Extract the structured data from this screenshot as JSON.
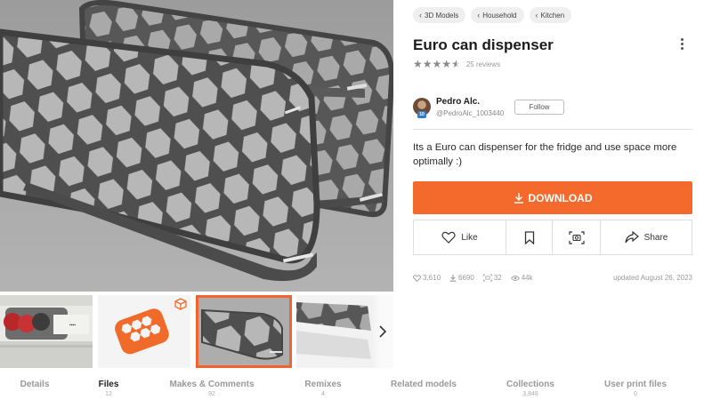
{
  "breadcrumbs": [
    "3D Models",
    "Household",
    "Kitchen"
  ],
  "model": {
    "title": "Euro can dispenser",
    "rating": 4.5,
    "reviews": "25 reviews",
    "description": "Its a Euro can dispenser for the fridge and use space more optimally :)"
  },
  "author": {
    "name": "Pedro Alc.",
    "handle": "@PedroAlc_1003440",
    "badge": "10",
    "follow_label": "Follow"
  },
  "download_label": "DOWNLOAD",
  "actions": {
    "like": "Like",
    "share": "Share"
  },
  "stats": {
    "likes": "3,610",
    "downloads": "6690",
    "makes": "32",
    "views": "44k",
    "updated": "updated August 26, 2023"
  },
  "tabs": [
    {
      "label": "Details",
      "count": ""
    },
    {
      "label": "Files",
      "count": "12",
      "active": true
    },
    {
      "label": "Makes & Comments",
      "count": "92"
    },
    {
      "label": "Remixes",
      "count": "4"
    },
    {
      "label": "Related models",
      "count": ""
    },
    {
      "label": "Collections",
      "count": "3,848"
    },
    {
      "label": "User print files",
      "count": "0"
    }
  ],
  "colors": {
    "accent": "#f36a2c",
    "star": "#8a8a8a",
    "model_gray": "#555555"
  },
  "icons": [
    "chevron-left-icon",
    "kebab-menu-icon",
    "star-icon",
    "download-icon",
    "heart-icon",
    "bookmark-icon",
    "camera-scan-icon",
    "share-icon",
    "eye-icon",
    "chevron-right-icon",
    "cube-icon"
  ]
}
